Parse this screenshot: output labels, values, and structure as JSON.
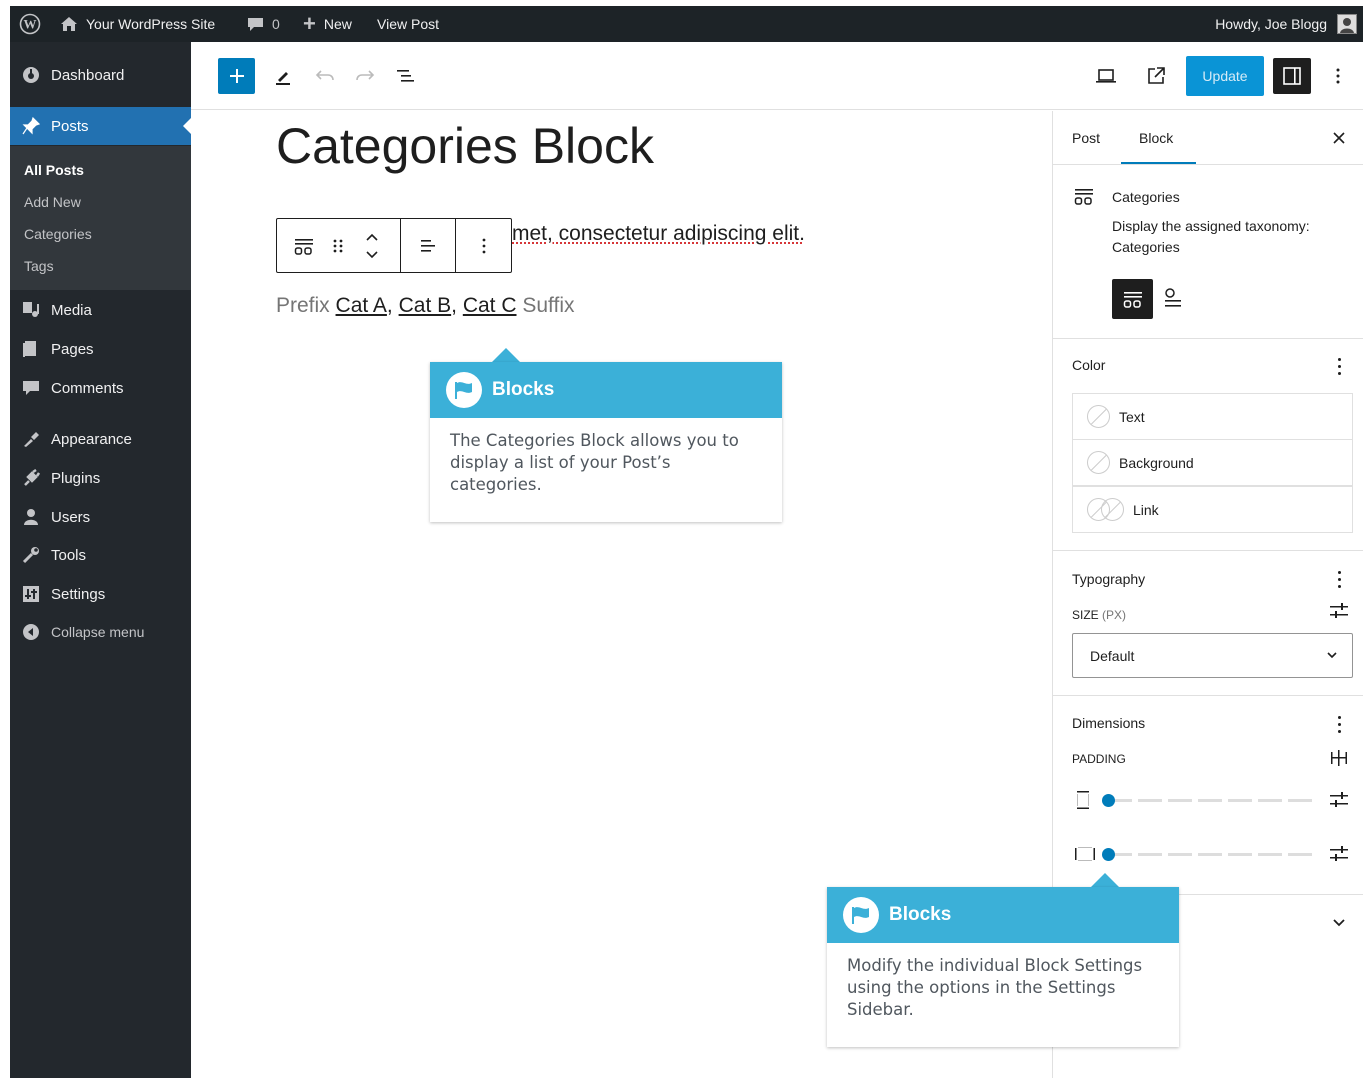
{
  "admin_bar": {
    "site_name": "Your WordPress Site",
    "comments_count": "0",
    "new_label": "New",
    "view_post_label": "View Post",
    "greeting": "Howdy, Joe Blogg"
  },
  "sidebar": {
    "items": [
      {
        "label": "Dashboard",
        "icon": "dashboard-icon"
      },
      {
        "label": "Posts",
        "icon": "pin-icon",
        "active": true
      },
      {
        "label": "Media",
        "icon": "media-icon"
      },
      {
        "label": "Pages",
        "icon": "pages-icon"
      },
      {
        "label": "Comments",
        "icon": "comments-icon"
      },
      {
        "label": "Appearance",
        "icon": "appearance-icon"
      },
      {
        "label": "Plugins",
        "icon": "plugins-icon"
      },
      {
        "label": "Users",
        "icon": "users-icon"
      },
      {
        "label": "Tools",
        "icon": "tools-icon"
      },
      {
        "label": "Settings",
        "icon": "settings-icon"
      },
      {
        "label": "Collapse menu",
        "icon": "collapse-icon"
      }
    ],
    "posts_submenu": [
      "All Posts",
      "Add New",
      "Categories",
      "Tags"
    ]
  },
  "toolbar": {
    "update_label": "Update"
  },
  "editor": {
    "title": "Categories Block",
    "paragraph_visible": "met, consectetur adipiscing elit.",
    "prefix": "Prefix",
    "categories": [
      "Cat A",
      "Cat B",
      "Cat C"
    ],
    "suffix": "Suffix"
  },
  "callouts": [
    {
      "title": "Blocks",
      "body": "The Categories Block allows you to display a list of your Post’s categories."
    },
    {
      "title": "Blocks",
      "body": "Modify the individual Block Settings using the options in the Settings Sidebar."
    }
  ],
  "settings": {
    "tabs": [
      "Post",
      "Block"
    ],
    "active_tab": "Block",
    "block_name": "Categories",
    "block_description": "Display the assigned taxonomy: Categories",
    "color": {
      "title": "Color",
      "rows": [
        "Text",
        "Background",
        "Link"
      ]
    },
    "typography": {
      "title": "Typography",
      "size_label": "SIZE",
      "size_unit": "(PX)",
      "size_value": "Default"
    },
    "dimensions": {
      "title": "Dimensions",
      "padding_label": "PADDING",
      "vertical_padding_value": 0,
      "horizontal_padding_value": 0
    }
  },
  "colors": {
    "admin_bar_bg": "#1d2327",
    "sidebar_bg": "#23282d",
    "active_menu": "#2271b1",
    "wp_blue": "#007cba",
    "callout_header": "#3bb0d8"
  }
}
